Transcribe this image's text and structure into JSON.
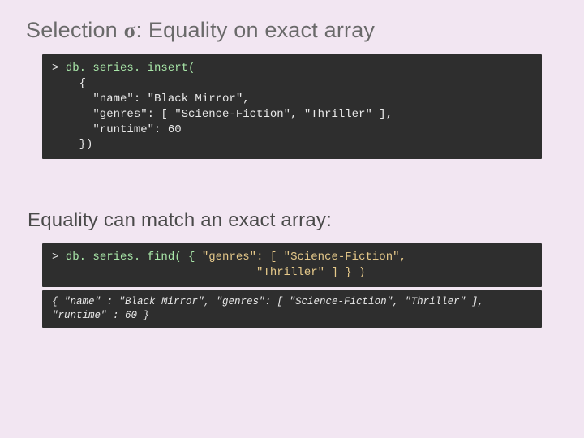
{
  "title_pre": "Selection ",
  "title_sigma": "σ",
  "title_post": ": Equality on exact array",
  "code1": {
    "prompt": "> ",
    "cmd": "db. series. insert(",
    "body": "    {\n      \"name\": \"Black Mirror\",\n      \"genres\": [ \"Science-Fiction\", \"Thriller\" ],\n      \"runtime\": 60\n    })"
  },
  "subtitle": "Equality can match an exact array:",
  "code2": {
    "prompt1": "> ",
    "cmd_pre": "db. series. find( {",
    "str1": " \"genres\": [ \"Science-Fiction\",",
    "line2_indent": "                    ",
    "str2": "          \"Thriller\" ] } )"
  },
  "result": "{ \"name\" : \"Black Mirror\", \"genres\": [ \"Science-Fiction\", \"Thriller\" ], \"runtime\" : 60 }"
}
